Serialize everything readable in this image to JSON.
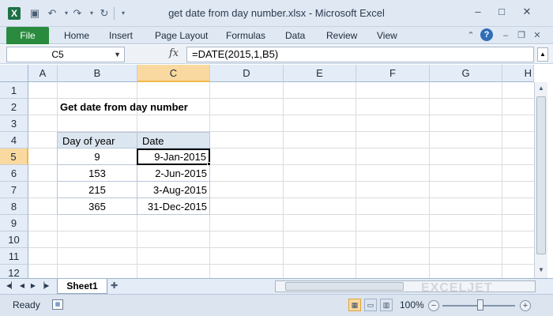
{
  "window": {
    "title": "get date from day number.xlsx  -  Microsoft Excel",
    "app_icon": "excel-icon",
    "minimize": "–",
    "maximize": "□",
    "close": "✕"
  },
  "quick_access": {
    "save": "save-icon",
    "undo": "undo-icon",
    "redo": "redo-icon",
    "refresh": "refresh-icon",
    "customize": "customize-icon"
  },
  "ribbon": {
    "file_label": "File",
    "tabs": [
      "Home",
      "Insert",
      "Page Layout",
      "Formulas",
      "Data",
      "Review",
      "View"
    ]
  },
  "formula_bar": {
    "name_box": "C5",
    "fx": "fx",
    "formula": "=DATE(2015,1,B5)"
  },
  "grid": {
    "columns": [
      "A",
      "B",
      "C",
      "D",
      "E",
      "F",
      "G",
      "H"
    ],
    "rows": [
      "1",
      "2",
      "3",
      "4",
      "5",
      "6",
      "7",
      "8",
      "9",
      "10",
      "11",
      "12"
    ],
    "selected_column": "C",
    "selected_row": "5"
  },
  "sheet": {
    "heading": "Get date from day number",
    "table_headers": [
      "Day of year",
      "Date"
    ],
    "table_rows": [
      {
        "day": "9",
        "date": "9-Jan-2015"
      },
      {
        "day": "153",
        "date": "2-Jun-2015"
      },
      {
        "day": "215",
        "date": "3-Aug-2015"
      },
      {
        "day": "365",
        "date": "31-Dec-2015"
      }
    ]
  },
  "sheet_tabs": {
    "active": "Sheet1"
  },
  "watermark": "EXCELJET",
  "status_bar": {
    "status": "Ready",
    "zoom": "100%",
    "zoom_minus": "−",
    "zoom_plus": "+"
  },
  "colors": {
    "file_tab": "#2a8b3e",
    "selected_header": "#f9d99f",
    "table_header": "#dce6f1"
  }
}
